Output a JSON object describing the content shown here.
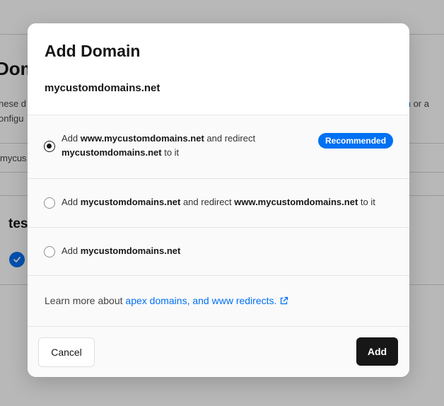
{
  "background": {
    "heading_fragment": "Dom",
    "text_line1": "hese d",
    "text_line2": "onfigu",
    "link_fragment": "nch",
    "link_after": " or a",
    "row_fragment": "mycus",
    "subheading_fragment": "tes"
  },
  "modal": {
    "title": "Add Domain",
    "domain": "mycustomdomains.net",
    "options": [
      {
        "checked": true,
        "prefix": "Add ",
        "bold1": "www.mycustomdomains.net",
        "middle": " and redirect",
        "bold2": "mycustomdomains.net",
        "suffix": " to it",
        "badge": "Recommended"
      },
      {
        "checked": false,
        "prefix": "Add ",
        "bold1": "mycustomdomains.net",
        "middle": " and redirect ",
        "bold2": "www.mycustomdomains.net",
        "suffix": " to it"
      },
      {
        "checked": false,
        "prefix": "Add ",
        "bold1": "mycustomdomains.net"
      }
    ],
    "learn_prefix": "Learn more about ",
    "learn_link": "apex domains, and www redirects.",
    "cancel_label": "Cancel",
    "add_label": "Add"
  },
  "colors": {
    "accent": "#0070f3",
    "primary_button": "#171717",
    "overlay": "rgba(0,0,0,0.28)"
  },
  "icons": {
    "external": "external-link-icon",
    "check": "check-icon"
  }
}
